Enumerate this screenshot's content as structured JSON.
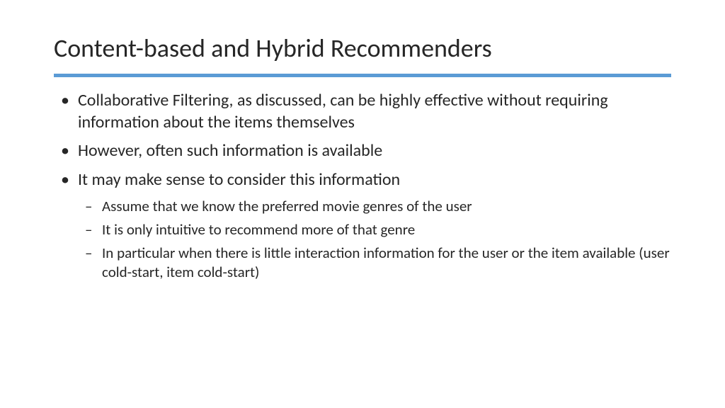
{
  "slide": {
    "title": "Content-based and Hybrid Recommenders",
    "bullets": [
      {
        "text": "Collaborative Filtering, as discussed, can be highly effective without requiring information about the items themselves",
        "sub": []
      },
      {
        "text": "However, often such information is available",
        "sub": []
      },
      {
        "text": "It may make sense to consider this information",
        "sub": [
          "Assume that we know the preferred movie genres of the user",
          "It is only intuitive to recommend more of that genre",
          "In particular when there is little interaction information for the user or the item available (user cold-start, item cold-start)"
        ]
      }
    ]
  },
  "accent_color": "#5b9bd5"
}
